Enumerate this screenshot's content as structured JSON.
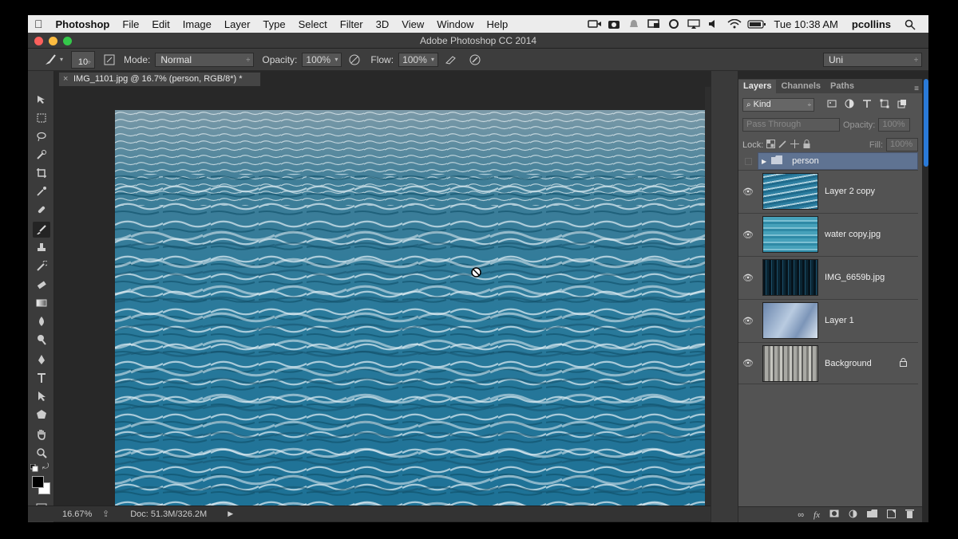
{
  "menubar": {
    "app_name": "Photoshop",
    "items": [
      "File",
      "Edit",
      "Image",
      "Layer",
      "Type",
      "Select",
      "Filter",
      "3D",
      "View",
      "Window",
      "Help"
    ],
    "clock": "Tue 10:38 AM",
    "user": "pcollins"
  },
  "window": {
    "title": "Adobe Photoshop CC 2014"
  },
  "options_bar": {
    "brush_size": "10",
    "mode_label": "Mode:",
    "mode_value": "Normal",
    "opacity_label": "Opacity:",
    "opacity_value": "100%",
    "flow_label": "Flow:",
    "flow_value": "100%",
    "workspace_value": "Uni"
  },
  "document": {
    "tab_title": "IMG_1101.jpg @ 16.7% (person, RGB/8*) *"
  },
  "status": {
    "zoom": "16.67%",
    "doc_info": "Doc: 51.3M/326.2M"
  },
  "panel": {
    "tabs": [
      "Layers",
      "Channels",
      "Paths"
    ],
    "active_tab": "Layers",
    "filter_kind": "Kind",
    "blend_mode": "Pass Through",
    "opacity_label": "Opacity:",
    "opacity_value": "100%",
    "lock_label": "Lock:",
    "fill_label": "Fill:",
    "fill_value": "100%",
    "group_name": "person",
    "layers": [
      {
        "name": "Layer 2 copy",
        "visible": true,
        "thumb_color": "#3a8fb0"
      },
      {
        "name": "water copy.jpg",
        "visible": true,
        "thumb_color": "#4aa0b8"
      },
      {
        "name": "IMG_6659b.jpg",
        "visible": true,
        "thumb_color": "#0e2a3a"
      },
      {
        "name": "Layer 1",
        "visible": true,
        "thumb_color": "#8fa8c8"
      },
      {
        "name": "Background",
        "visible": true,
        "locked": true,
        "thumb_color": "#8a8a88"
      }
    ]
  },
  "colors": {
    "foreground": "#000000",
    "background": "#ffffff",
    "water_deep": "#1e6f8e",
    "water_light": "#c6dbe4"
  }
}
